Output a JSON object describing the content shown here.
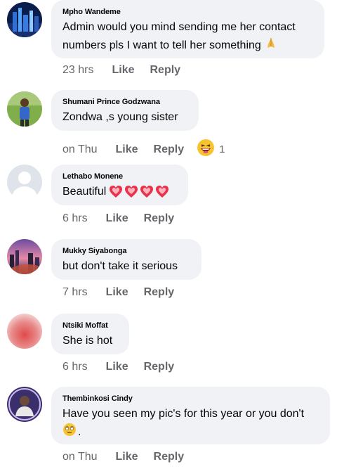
{
  "comments": [
    {
      "name": "Mpho Wandeme",
      "text_line1": "Admin would you mind sending me her contact",
      "text_line2": "numbers pls I want to tell her something",
      "time": "23 hrs",
      "like": "Like",
      "reply": "Reply"
    },
    {
      "name": "Shumani Prince Godzwana",
      "text": "Zondwa ,s young sister",
      "time": "on Thu",
      "like": "Like",
      "reply": "Reply",
      "reaction_count": "1"
    },
    {
      "name": "Lethabo Monene",
      "text": "Beautiful",
      "time": "6 hrs",
      "like": "Like",
      "reply": "Reply"
    },
    {
      "name": "Mukky Siyabonga",
      "text": "but don't take it serious",
      "time": "7 hrs",
      "like": "Like",
      "reply": "Reply"
    },
    {
      "name": "Ntsiki Moffat",
      "text": "She is hot",
      "time": "6 hrs",
      "like": "Like",
      "reply": "Reply"
    },
    {
      "name": "Thembinkosi Cindy",
      "text_line1": "Have you seen my pic's for this year or you don't",
      "text_line2": ".",
      "time": "on Thu",
      "like": "Like",
      "reply": "Reply"
    }
  ],
  "colors": {
    "bubble": "#f0f2f5",
    "meta": "#65676b",
    "text": "#050505"
  }
}
